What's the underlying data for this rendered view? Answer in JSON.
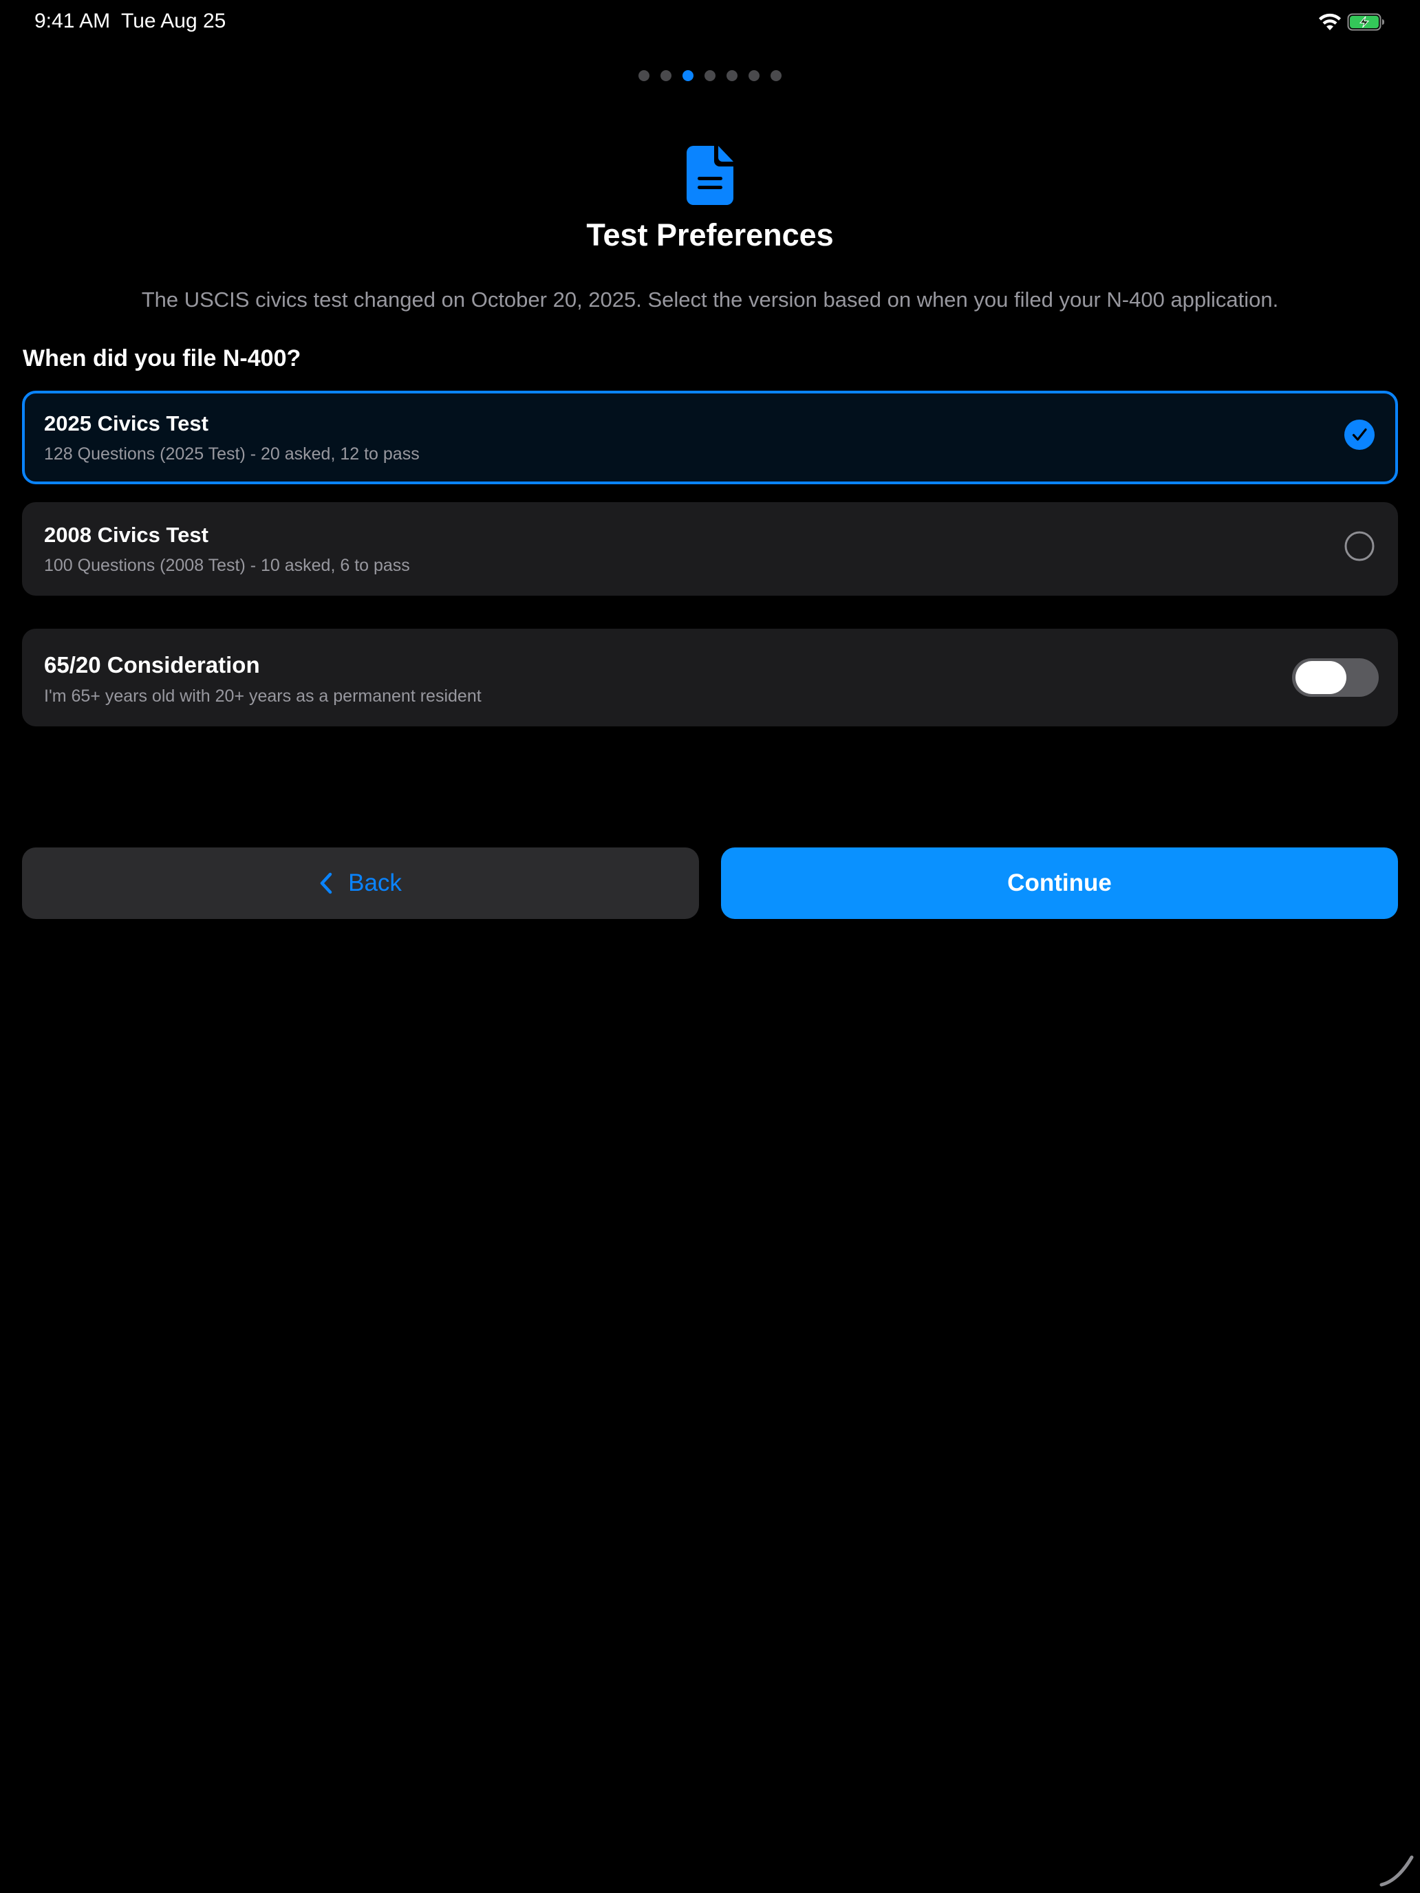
{
  "status_bar": {
    "time": "9:41 AM",
    "date": "Tue Aug 25",
    "icons": [
      "wifi-icon",
      "battery-charging-icon"
    ]
  },
  "page_indicator": {
    "total": 7,
    "active_index": 2
  },
  "header": {
    "icon": "document-icon",
    "title": "Test Preferences",
    "subtitle": "The USCIS civics test changed on October 20, 2025. Select the version based on when you filed your N-400 application."
  },
  "question": {
    "label": "When did you file N-400?"
  },
  "options": [
    {
      "title": "2025 Civics Test",
      "description": "128 Questions (2025 Test) - 20 asked, 12 to pass",
      "selected": true
    },
    {
      "title": "2008 Civics Test",
      "description": "100 Questions (2008 Test) - 10 asked, 6 to pass",
      "selected": false
    }
  ],
  "consideration": {
    "title": "65/20 Consideration",
    "description": "I'm 65+ years old with 20+ years as a permanent resident",
    "enabled": false
  },
  "buttons": {
    "back": "Back",
    "continue": "Continue"
  },
  "colors": {
    "background": "#000000",
    "accent": "#0a84ff",
    "card": "#1c1c1e",
    "secondary_text": "#98989f",
    "battery_green": "#34c759"
  }
}
